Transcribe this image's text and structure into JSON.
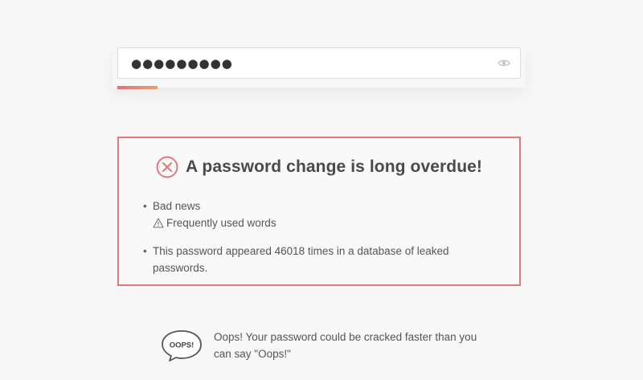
{
  "password": {
    "masked_value": "●●●●●●●●●",
    "eye_icon": "eye-icon",
    "strength_fraction": 0.1,
    "strength_color_start": "#e0707a",
    "strength_color_end": "#e9a070"
  },
  "result": {
    "status_icon": "error-x-icon",
    "status_color": "#e07a7a",
    "title": "A password change is long overdue!",
    "findings": [
      {
        "label": "Bad news",
        "warning_icon": "warning-triangle-icon",
        "warning": "Frequently used words"
      },
      {
        "text": "This password appeared 46018 times in a database of leaked passwords."
      }
    ]
  },
  "oops": {
    "bubble_text": "OOPS!",
    "message": "Oops! Your password could be cracked faster than you can say \"Oops!\""
  }
}
